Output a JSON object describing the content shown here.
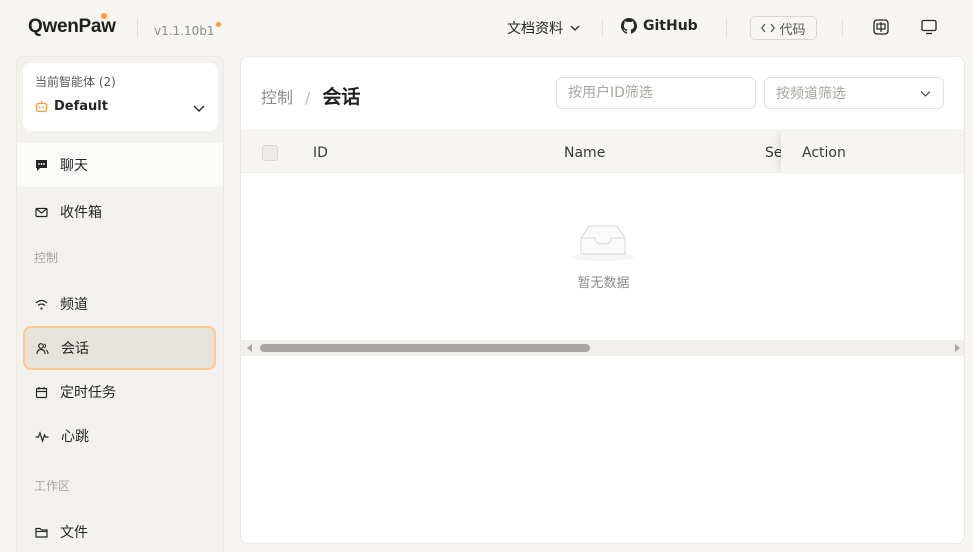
{
  "header": {
    "brand": "QwenPaw",
    "version": "v1.1.10b1",
    "docs_label": "文档资料",
    "github_label": "GitHub",
    "code_label": "代码",
    "accent_color": "#ff9a3c"
  },
  "sidebar": {
    "agent_label": "当前智能体 (2)",
    "agent_name": "Default",
    "items": [
      {
        "label": "聊天",
        "icon": "chat-icon"
      },
      {
        "label": "收件箱",
        "icon": "mail-icon"
      }
    ],
    "section_control": "控制",
    "control_items": [
      {
        "label": "频道",
        "icon": "wifi-icon"
      },
      {
        "label": "会话",
        "icon": "users-icon",
        "active": true
      },
      {
        "label": "定时任务",
        "icon": "calendar-icon"
      },
      {
        "label": "心跳",
        "icon": "pulse-icon"
      }
    ],
    "section_workspace": "工作区",
    "workspace_items": [
      {
        "label": "文件",
        "icon": "folder-icon"
      }
    ]
  },
  "main": {
    "breadcrumb_parent": "控制",
    "breadcrumb_sep": "/",
    "title": "会话",
    "filter_user_placeholder": "按用户ID筛选",
    "filter_channel_placeholder": "按频道筛选",
    "columns": [
      "ID",
      "Name",
      "Se:",
      "Action"
    ],
    "empty_text": "暂无数据"
  }
}
